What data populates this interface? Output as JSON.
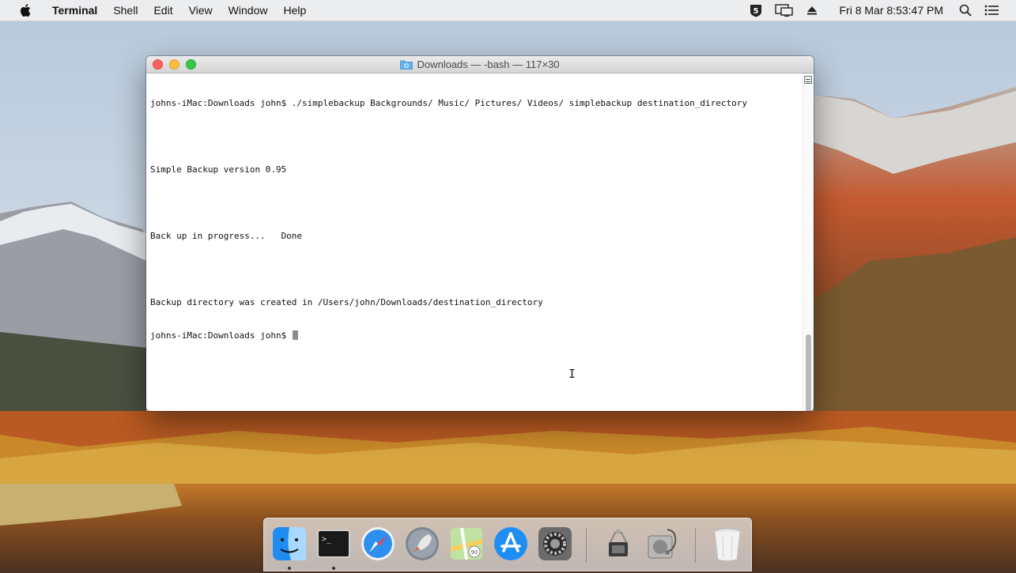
{
  "menubar": {
    "apple_icon": "apple-icon",
    "app_name": "Terminal",
    "items": [
      "Shell",
      "Edit",
      "View",
      "Window",
      "Help"
    ],
    "clock": "Fri 8 Mar  8:53:47 PM",
    "status_icons": [
      "shield-5-icon",
      "display-icon",
      "eject-icon",
      "search-icon",
      "list-icon"
    ]
  },
  "window": {
    "title": "Downloads — -bash — 117×30",
    "lines": [
      "johns-iMac:Downloads john$ ./simplebackup Backgrounds/ Music/ Pictures/ Videos/ simplebackup destination_directory",
      "",
      "Simple Backup version 0.95",
      "",
      "Back up in progress...   Done",
      "",
      "Backup directory was created in /Users/john/Downloads/destination_directory",
      "johns-iMac:Downloads john$ "
    ]
  },
  "colors": {
    "close": "#fc615d",
    "minimize": "#fdbc40",
    "maximize": "#34c84a"
  },
  "dock": {
    "items": [
      {
        "name": "finder-icon",
        "running": true
      },
      {
        "name": "terminal-icon",
        "running": true
      },
      {
        "name": "safari-icon",
        "running": false
      },
      {
        "name": "launchpad-icon",
        "running": false
      },
      {
        "name": "maps-icon",
        "running": false
      },
      {
        "name": "app-store-icon",
        "running": false
      },
      {
        "name": "system-preferences-icon",
        "running": false
      },
      {
        "name": "system-information-icon",
        "running": false
      },
      {
        "name": "disk-utility-icon",
        "running": false
      },
      {
        "name": "trash-icon",
        "running": false
      }
    ]
  }
}
